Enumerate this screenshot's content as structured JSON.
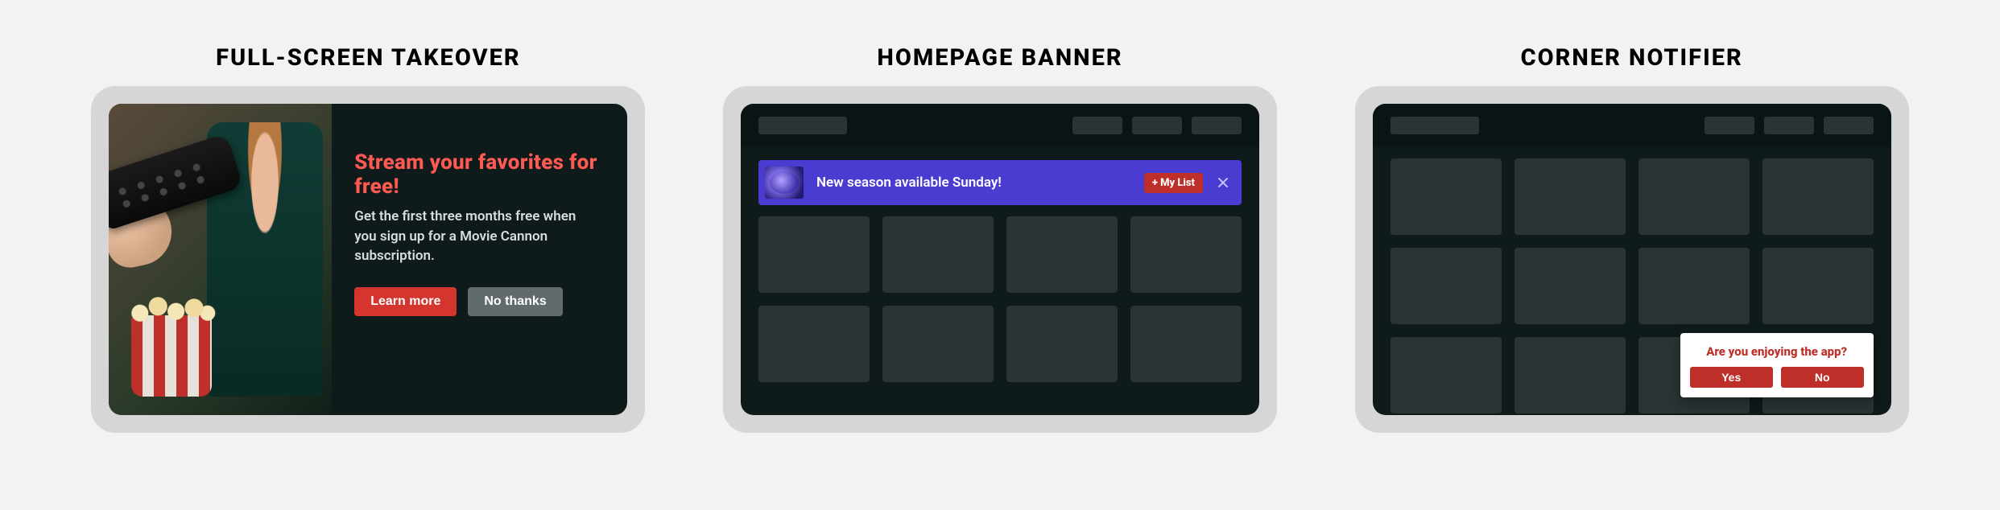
{
  "panels": [
    {
      "title": "FULL-SCREEN TAKEOVER"
    },
    {
      "title": "HOMEPAGE BANNER"
    },
    {
      "title": "CORNER NOTIFIER"
    }
  ],
  "takeover": {
    "headline": "Stream your favorites for free!",
    "body": "Get the first three months free when you sign up for a Movie Cannon subscription.",
    "primary": "Learn more",
    "secondary": "No thanks"
  },
  "banner": {
    "message": "New season available Sunday!",
    "cta": "+ My List"
  },
  "notifier": {
    "question": "Are you enjoying the app?",
    "yes": "Yes",
    "no": "No"
  },
  "colors": {
    "accent": "#d4352e",
    "banner": "#4a3bd1",
    "tv": "#0f1a1a"
  }
}
